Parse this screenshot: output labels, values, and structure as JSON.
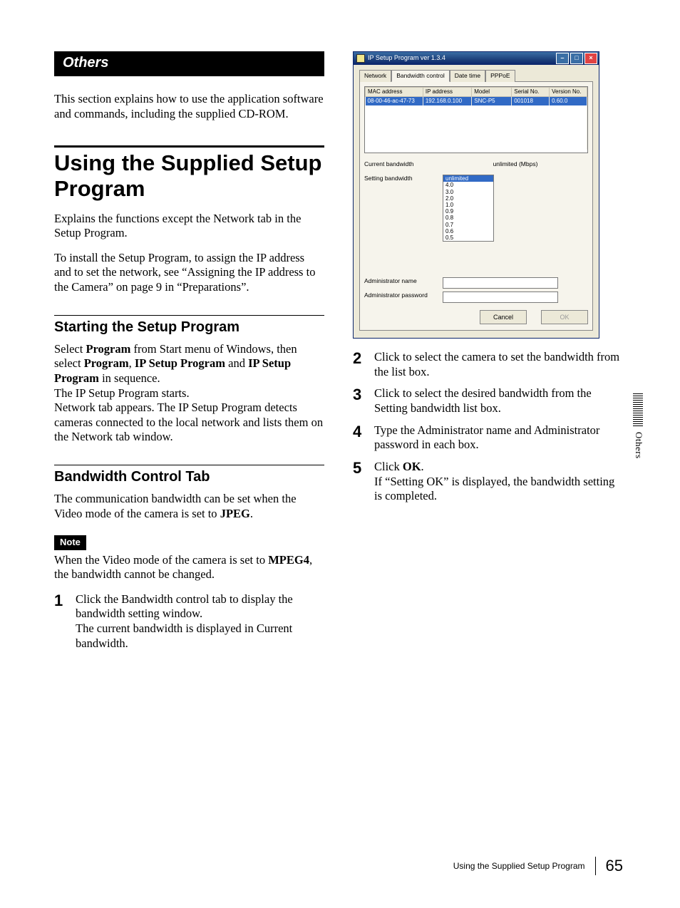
{
  "section_bar": "Others",
  "intro": "This section explains how to use the application software and commands, including the supplied CD-ROM.",
  "main_title": "Using the Supplied Setup Program",
  "main_para1": "Explains the functions except the Network tab in the Setup Program.",
  "main_para2": "To install the Setup Program, to assign the IP address and to set the network, see “Assigning the IP address to the Camera” on page 9 in “Preparations”.",
  "h2_start": "Starting the Setup Program",
  "start_p1_a": "Select ",
  "start_p1_b": "Program",
  "start_p1_c": " from Start menu of Windows, then select ",
  "start_p1_d": "Program",
  "start_p1_e": ", ",
  "start_p1_f": "IP Setup Program",
  "start_p1_g": " and ",
  "start_p1_h": "IP Setup Program",
  "start_p1_i": " in sequence.",
  "start_p2": "The IP Setup Program starts.",
  "start_p3": "Network tab appears. The IP Setup Program detects cameras connected to the local network and lists them on the Network tab window.",
  "h2_bw": "Bandwidth Control Tab",
  "bw_p1_a": "The communication bandwidth can be set when the Video mode of the camera is set to ",
  "bw_p1_b": "JPEG",
  "bw_p1_c": ".",
  "note_label": "Note",
  "note_p_a": "When the Video mode of the camera is set to ",
  "note_p_b": "MPEG4",
  "note_p_c": ", the bandwidth cannot be changed.",
  "steps_left": [
    {
      "n": "1",
      "body_a": "Click the Bandwidth control tab to display the bandwidth setting window.",
      "body_b": "The current bandwidth is displayed in Current bandwidth."
    }
  ],
  "steps_right": [
    {
      "n": "2",
      "body_a": "Click to select the camera to set the bandwidth from the list box."
    },
    {
      "n": "3",
      "body_a": "Click to select the desired bandwidth from the Setting bandwidth list box."
    },
    {
      "n": "4",
      "body_a": "Type the Administrator name and Administrator password in each box."
    },
    {
      "n": "5",
      "body_a": "Click ",
      "bold": "OK",
      "body_b": ".",
      "body_c": "If “Setting OK” is displayed, the bandwidth setting is completed."
    }
  ],
  "app": {
    "title": "IP Setup Program ver 1.3.4",
    "tabs": [
      "Network",
      "Bandwidth control",
      "Date time",
      "PPPoE"
    ],
    "active_tab": 1,
    "table": {
      "headers": [
        "MAC address",
        "IP address",
        "Model",
        "Serial No.",
        "Version No."
      ],
      "row": [
        "08-00-46-ac-47-73",
        "192.168.0.100",
        "SNC-P5",
        "001018",
        "0.60.0"
      ]
    },
    "current_bw_label": "Current bandwidth",
    "current_bw_value": "unlimited  (Mbps)",
    "setting_bw_label": "Setting bandwidth",
    "bw_options": [
      "unlimited",
      "4.0",
      "3.0",
      "2.0",
      "1.0",
      "0.9",
      "0.8",
      "0.7",
      "0.6",
      "0.5"
    ],
    "admin_name_label": "Administrator name",
    "admin_pass_label": "Administrator password",
    "btn_cancel": "Cancel",
    "btn_ok": "OK"
  },
  "side_label": "Others",
  "footer_text": "Using the Supplied Setup Program",
  "page_number": "65"
}
